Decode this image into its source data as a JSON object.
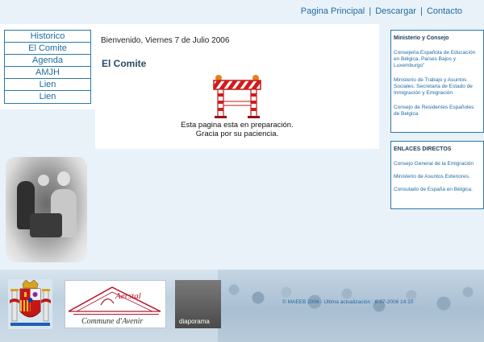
{
  "topnav": {
    "home": "Pagina Principal",
    "download": "Descargar",
    "contact": "Contacto",
    "sep": "|"
  },
  "leftmenu": [
    "Historico",
    "El Comite",
    "Agenda",
    "AMJH",
    "Lien",
    "Lien"
  ],
  "main": {
    "welcome": "Bienvenido, Viernes 7 de Julio 2006",
    "title": "El Comite",
    "message_line1": "Esta pagina esta en preparación.",
    "message_line2": "Gracia por su paciencia."
  },
  "rightbox1": {
    "heading": "Ministerio y Consejo",
    "links": [
      "Consejeria Española de Educación en Bélgica, Países Bajos y Luxemburgo\"",
      "Ministerio de Trabajo y Asuntos Sociales: Secretaria de Estado de Inmigración y Emigración",
      "Consejo de Residentes Españoles de Belgica"
    ]
  },
  "rightbox2": {
    "heading": "ENLACES DIRECTOS",
    "links": [
      "Consejo General de la Emigración",
      "Ministerio de Asuntos Exteriores.",
      "Consulado de España en Bélgica."
    ]
  },
  "footer": {
    "aerstal_name": "Aerstal",
    "aerstal_sub": "Commune d'Avenir",
    "diaporama": "diaporama",
    "copyright": "© MAEEB 2006 - Ultima actualización : 6-07-2006 14:10"
  },
  "colors": {
    "accent": "#1f6aa0",
    "border": "#2c78a8",
    "background": "#e9f2f9"
  }
}
